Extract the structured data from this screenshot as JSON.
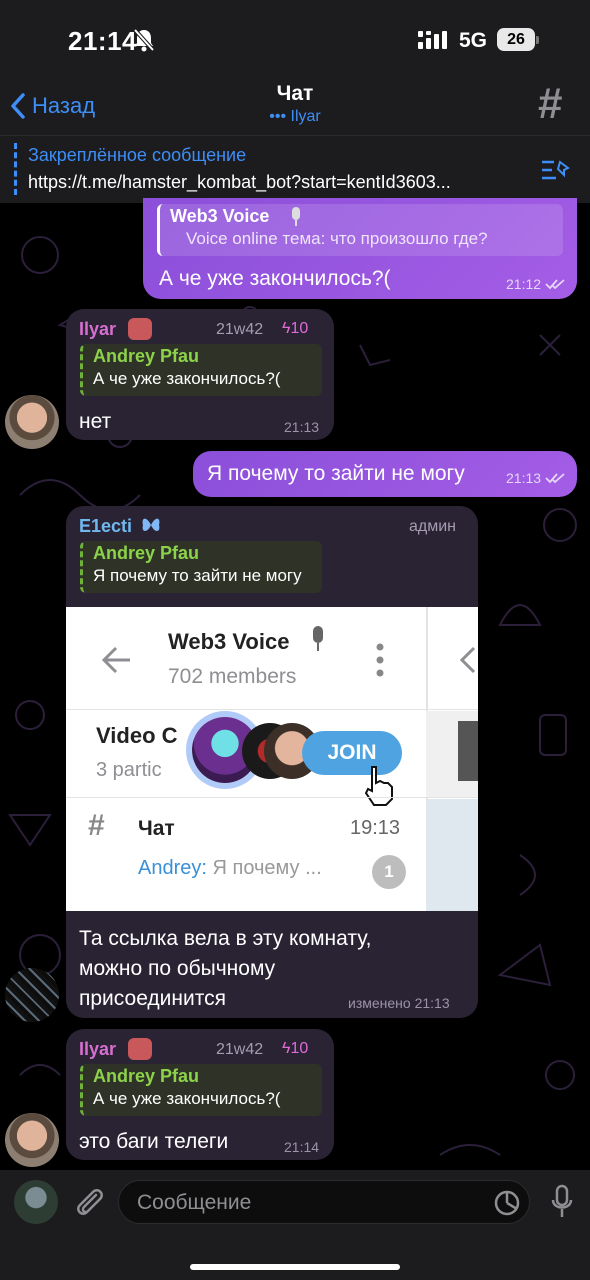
{
  "status": {
    "time": "21:14",
    "network": "5G",
    "battery": "26"
  },
  "nav": {
    "back_label": "Назад",
    "title": "Чат",
    "subtitle": "••• Ilyar"
  },
  "pinned": {
    "title": "Закреплённое сообщение",
    "text": "https://t.me/hamster_kombat_bot?start=kentId3603..."
  },
  "messages": [
    {
      "type": "outgoing",
      "reply_name": "Web3 Voice",
      "reply_text": "Voice online тема: что произошло где?",
      "text": "А че уже закончилось?(",
      "time": "21:12"
    },
    {
      "type": "incoming",
      "sender": "Ilyar",
      "tag": "21w42",
      "boost": "10",
      "reply_name": "Andrey Pfau",
      "reply_text": "А че уже закончилось?(",
      "text": "нет",
      "time": "21:13"
    },
    {
      "type": "outgoing",
      "text": "Я почему то зайти не могу",
      "time": "21:13"
    },
    {
      "type": "incoming",
      "sender": "E1ecti",
      "tag": "админ",
      "reply_name": "Andrey Pfau",
      "reply_text": "Я почему то зайти не могу",
      "text_lines": [
        "Та ссылка вела в эту комнату,",
        "можно по обычному",
        "присоединится"
      ],
      "time": "изменено 21:13"
    },
    {
      "type": "incoming",
      "sender": "Ilyar",
      "tag": "21w42",
      "boost": "10",
      "reply_name": "Andrey Pfau",
      "reply_text": "А че уже закончилось?(",
      "text": "это баги телеги",
      "time": "21:14"
    }
  ],
  "screenshot": {
    "group_name": "Web3 Voice",
    "members": "702 members",
    "video_chat_label": "Video C",
    "participants": "3 partic",
    "join_label": "JOIN",
    "chat_name": "Чат",
    "chat_time": "19:13",
    "last_sender": "Andrey:",
    "last_text": "Я почему ...",
    "unread": "1"
  },
  "input": {
    "placeholder": "Сообщение"
  },
  "colors": {
    "accent": "#3e8ef7",
    "outgoing": "#9a55e0",
    "incoming": "#2a2334",
    "reply_green": "#8cd24a"
  }
}
